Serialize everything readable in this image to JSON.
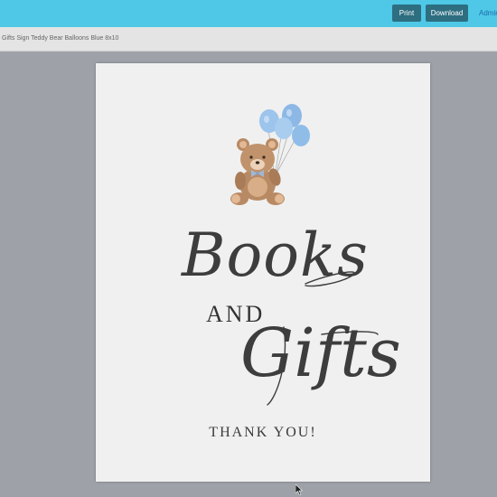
{
  "toolbar": {
    "print_label": "Print",
    "download_label": "Download",
    "admin_label": "Admin"
  },
  "document": {
    "title": "Gifts Sign Teddy Bear Balloons Blue 8x10"
  },
  "sign": {
    "line1": "Books",
    "line2": "AND",
    "line3": "Gifts",
    "line4": "THANK YOU!"
  },
  "icons": {
    "illustration": "teddy-bear-with-balloons",
    "pointer": "mouse-pointer-icon"
  },
  "colors": {
    "topbar": "#4ec8e6",
    "button": "#2d6e80",
    "balloon": "#8fbde8",
    "bear": "#b88a64",
    "text": "#3d3d3d"
  }
}
